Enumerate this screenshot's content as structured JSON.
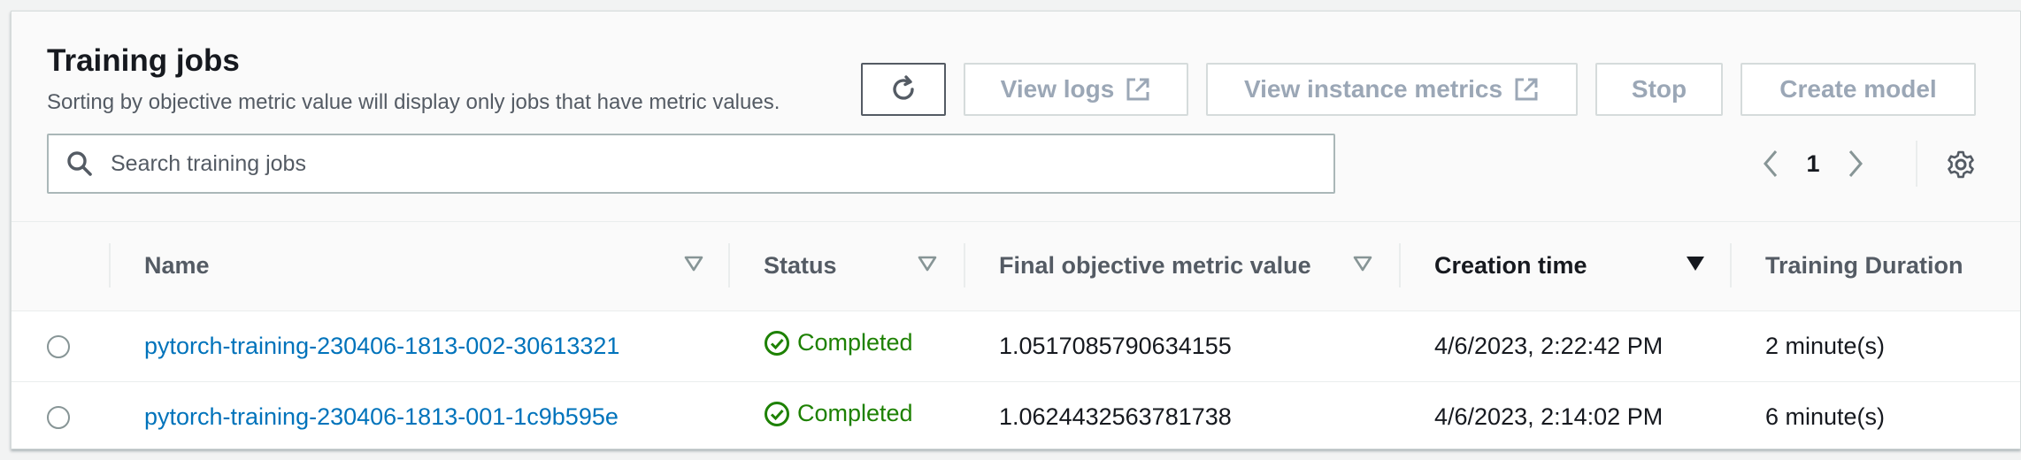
{
  "header": {
    "title": "Training jobs",
    "subtitle": "Sorting by objective metric value will display only jobs that have metric values."
  },
  "toolbar": {
    "refresh_icon": "refresh-icon",
    "view_logs_label": "View logs",
    "view_instance_metrics_label": "View instance metrics",
    "stop_label": "Stop",
    "create_model_label": "Create model",
    "external_icon": "external-link-icon"
  },
  "search": {
    "placeholder": "Search training jobs",
    "value": ""
  },
  "pagination": {
    "current_page": "1"
  },
  "table": {
    "columns": [
      {
        "label": "Name"
      },
      {
        "label": "Status"
      },
      {
        "label": "Final objective metric value"
      },
      {
        "label": "Creation time"
      },
      {
        "label": "Training Duration"
      }
    ],
    "sorted_column": "Creation time",
    "rows": [
      {
        "name": "pytorch-training-230406-1813-002-30613321",
        "status": "Completed",
        "metric": "1.0517085790634155",
        "created": "4/6/2023, 2:22:42 PM",
        "duration": "2 minute(s)"
      },
      {
        "name": "pytorch-training-230406-1813-001-1c9b595e",
        "status": "Completed",
        "metric": "1.0624432563781738",
        "created": "4/6/2023, 2:14:02 PM",
        "duration": "6 minute(s)"
      }
    ]
  },
  "colors": {
    "link": "#0073bb",
    "success": "#1d8102",
    "disabled": "#9ba7b6"
  }
}
